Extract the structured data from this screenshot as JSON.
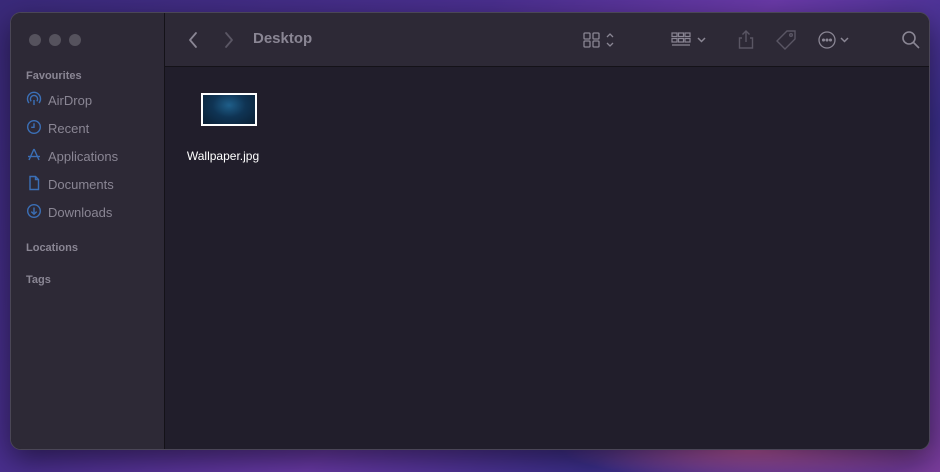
{
  "window": {
    "title": "Desktop"
  },
  "sidebar": {
    "favourites_title": "Favourites",
    "items": [
      {
        "label": "AirDrop",
        "icon": "airdrop-icon"
      },
      {
        "label": "Recent",
        "icon": "clock-icon"
      },
      {
        "label": "Applications",
        "icon": "applications-icon"
      },
      {
        "label": "Documents",
        "icon": "document-icon"
      },
      {
        "label": "Downloads",
        "icon": "download-icon"
      }
    ],
    "locations_title": "Locations",
    "tags_title": "Tags"
  },
  "toolbar": {
    "icons": [
      "back-icon",
      "forward-icon",
      "grid-view-icon",
      "group-icon",
      "share-icon",
      "tag-icon",
      "more-icon",
      "search-icon"
    ]
  },
  "files": [
    {
      "name": "Wallpaper.jpg"
    }
  ],
  "colors": {
    "sidebar_bg": "#2d2936",
    "content_bg": "#211e2b",
    "muted_text": "#8a8694",
    "accent_icon": "#3b6fb6"
  }
}
